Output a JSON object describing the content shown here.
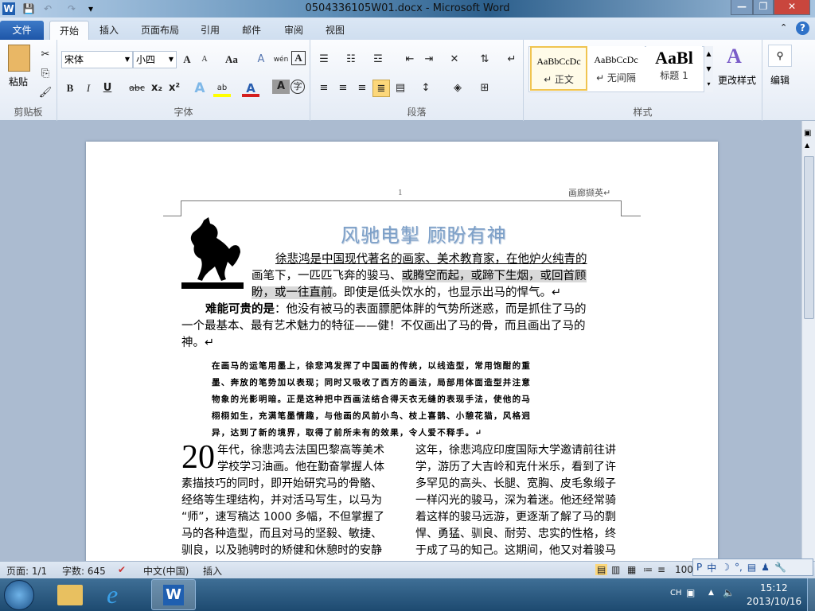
{
  "window": {
    "title": "0504336105W01.docx - Microsoft Word",
    "minimize": "—",
    "restore": "❐",
    "close": "✕"
  },
  "quick_access": {
    "word": "W",
    "save": "💾",
    "undo": "↶",
    "redo": "↷",
    "customize": "▾"
  },
  "tabs": [
    "文件",
    "开始",
    "插入",
    "页面布局",
    "引用",
    "邮件",
    "审阅",
    "视图"
  ],
  "ribbon": {
    "clipboard": {
      "paste": "粘贴",
      "label": "剪贴板"
    },
    "font": {
      "name": "宋体",
      "size": "小四",
      "label": "字体",
      "grow": "A",
      "shrink": "A",
      "case": "Aa",
      "clear": "A",
      "phonetic": "wén",
      "border": "A",
      "bold": "B",
      "italic": "I",
      "underline": "U",
      "strike": "abc",
      "sub": "x₂",
      "sup": "x²",
      "effects": "A",
      "highlight": "ab",
      "color": "A",
      "shade": "A",
      "enclose": "字"
    },
    "paragraph": {
      "label": "段落"
    },
    "styles": {
      "label": "样式",
      "items": [
        {
          "preview": "AaBbCcDc",
          "label": "↵ 正文"
        },
        {
          "preview": "AaBbCcDc",
          "label": "↵ 无间隔"
        },
        {
          "preview": "AaBl",
          "label": "标题 1"
        }
      ],
      "change": "更改样式"
    },
    "editing": {
      "label": "编辑"
    }
  },
  "document": {
    "header_page": "1",
    "header_right": "画廊撷英↵",
    "wordart": "风驰电掣 顾盼有神",
    "para1": [
      "徐悲鸿是中国现代著名的画家、美术教育家，在他炉火纯青的",
      "画笔下，一匹匹飞奔的骏马、",
      "或腾空而起，或蹄下生烟，或回首顾",
      "盼，或一往直前",
      "。即使是低头饮水的，也显示出马的悍气。↵"
    ],
    "para2_bold": "难能可贵的是",
    "para2": [
      "：他没有被马的表面膘肥体胖的气势所迷惑，而是抓住了马的",
      "一个最基本、最有艺术魅力的特征——健！不仅画出了马的骨，而且画出了马的",
      "神。↵"
    ],
    "quote": [
      "在画马的运笔用墨上，徐悲鸿发挥了中国画的传统，以线造型，常用饱酣的重",
      "墨、奔放的笔势加以表现；同时又吸收了西方的画法，局部用体面造型并注意",
      "物象的光影明暗。正是这种把中西画法结合得天衣无缝的表现手法，使他的马",
      "栩栩如生，充满笔墨情趣，与他画的风前小鸟、枝上喜鹊、小憩花猫，风格迥",
      "异，达到了新的境界，取得了前所未有的效果，令人爱不释手。↵"
    ],
    "dropcap": "20",
    "col1": [
      "年代，徐悲鸿去法国巴黎高等美术",
      "学校学习油画。他在勤奋掌握人体",
      "素描技巧的同时，即开始研究马的骨骼、",
      "经络等生理结构，并对活马写生，以马为",
      "“师”，速写稿达 1000 多幅，不但掌握了",
      "马的各种造型，而且对马的坚毅、敏捷、",
      "驯良，以及驰骋时的矫健和休憩时的安静"
    ],
    "col2": [
      "这年，徐悲鸿应印度国际大学邀请前往讲",
      "学，游历了大吉岭和克什米乐，看到了许",
      "多罕见的高头、长腿、宽胸、皮毛象缎子",
      "一样闪光的骏马，深为着迷。他还经常骑",
      "着这样的骏马远游，更逐渐了解了马的剽",
      "悍、勇猛、驯良、耐劳、忠实的性格，终",
      "于成了马的知己。这期间，他又对着骏马"
    ]
  },
  "status": {
    "page": "页面: 1/1",
    "words": "字数: 645",
    "language": "中文(中国)",
    "mode": "插入",
    "zoom": "100"
  },
  "ime": {
    "items": [
      "P",
      "中",
      "☽",
      "°,",
      "▤",
      "♟",
      "🔧"
    ]
  },
  "taskbar": {
    "lang": "CH",
    "time": "15:12",
    "date": "2013/10/16"
  }
}
